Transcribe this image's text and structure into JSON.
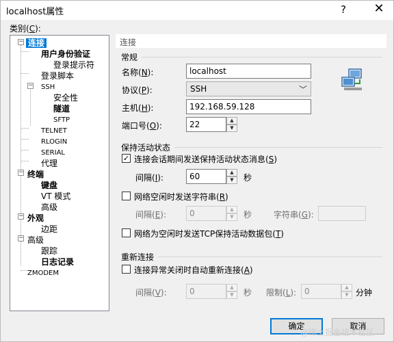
{
  "window": {
    "title": "localhost属性",
    "help": "?",
    "close": "✕"
  },
  "category_label_main": "类别(",
  "category_label_key": "C",
  "category_label_end": "):",
  "tree": {
    "connection": "连接",
    "user_auth": "用户身份验证",
    "login_prompt": "登录提示符",
    "login_script": "登录脚本",
    "ssh": "SSH",
    "security": "安全性",
    "tunnel": "隧道",
    "sftp": "SFTP",
    "telnet": "TELNET",
    "rlogin": "RLOGIN",
    "serial": "SERIAL",
    "proxy": "代理",
    "terminal": "终端",
    "keyboard": "键盘",
    "vt_mode": "VT 模式",
    "advanced1": "高级",
    "appearance": "外观",
    "margin": "边距",
    "advanced": "高级",
    "trace": "跟踪",
    "logging": "日志记录",
    "zmodem": "ZMODEM",
    "expand_minus": "−"
  },
  "section_title": "连接",
  "general": {
    "title": "常规",
    "name_label": "名称(",
    "name_key": "N",
    "name_end": "):",
    "name_value": "localhost",
    "protocol_label": "协议(",
    "protocol_key": "P",
    "protocol_end": "):",
    "protocol_value": "SSH",
    "host_label": "主机(",
    "host_key": "H",
    "host_end": "):",
    "host_value": "192.168.59.128",
    "port_label": "端口号(",
    "port_key": "O",
    "port_end": "):",
    "port_value": "22"
  },
  "keepalive": {
    "title": "保持活动状态",
    "send_label": "连接会话期间发送保持活动状态消息(",
    "send_key": "S",
    "send_end": ")",
    "send_checked": true,
    "interval_label": "间隔(",
    "interval_key": "I",
    "interval_end": "):",
    "interval_value": "60",
    "sec": "秒",
    "idle_string_label": "网络空闲时发送字符串(",
    "idle_string_key": "R",
    "idle_string_end": ")",
    "idle_string_checked": false,
    "interval2_label": "间隔(",
    "interval2_key": "E",
    "interval2_end": "):",
    "interval2_value": "0",
    "sec2": "秒",
    "string_label": "字符串(",
    "string_key": "G",
    "string_end": "):",
    "string_value": "",
    "tcp_label": "网络为空闲时发送TCP保持活动数据包(",
    "tcp_key": "T",
    "tcp_end": ")",
    "tcp_checked": false
  },
  "reconnect": {
    "title": "重新连接",
    "auto_label": "连接异常关闭时自动重新连接(",
    "auto_key": "A",
    "auto_end": ")",
    "auto_checked": false,
    "interval_label": "间隔(",
    "interval_key": "V",
    "interval_end": "):",
    "interval_value": "0",
    "sec": "秒",
    "limit_label": "限制(",
    "limit_key": "L",
    "limit_end": "):",
    "limit_value": "0",
    "minute": "分钟"
  },
  "buttons": {
    "ok": "确定",
    "cancel": "取消"
  },
  "spin": {
    "up": "▲",
    "down": "▼"
  },
  "combo_arrow": "﹀",
  "check_mark": "✓",
  "watermark": "@稀土掘金技术社区",
  "colors": {
    "selection": "#0078d7",
    "default_button_border": "#0078d7"
  }
}
